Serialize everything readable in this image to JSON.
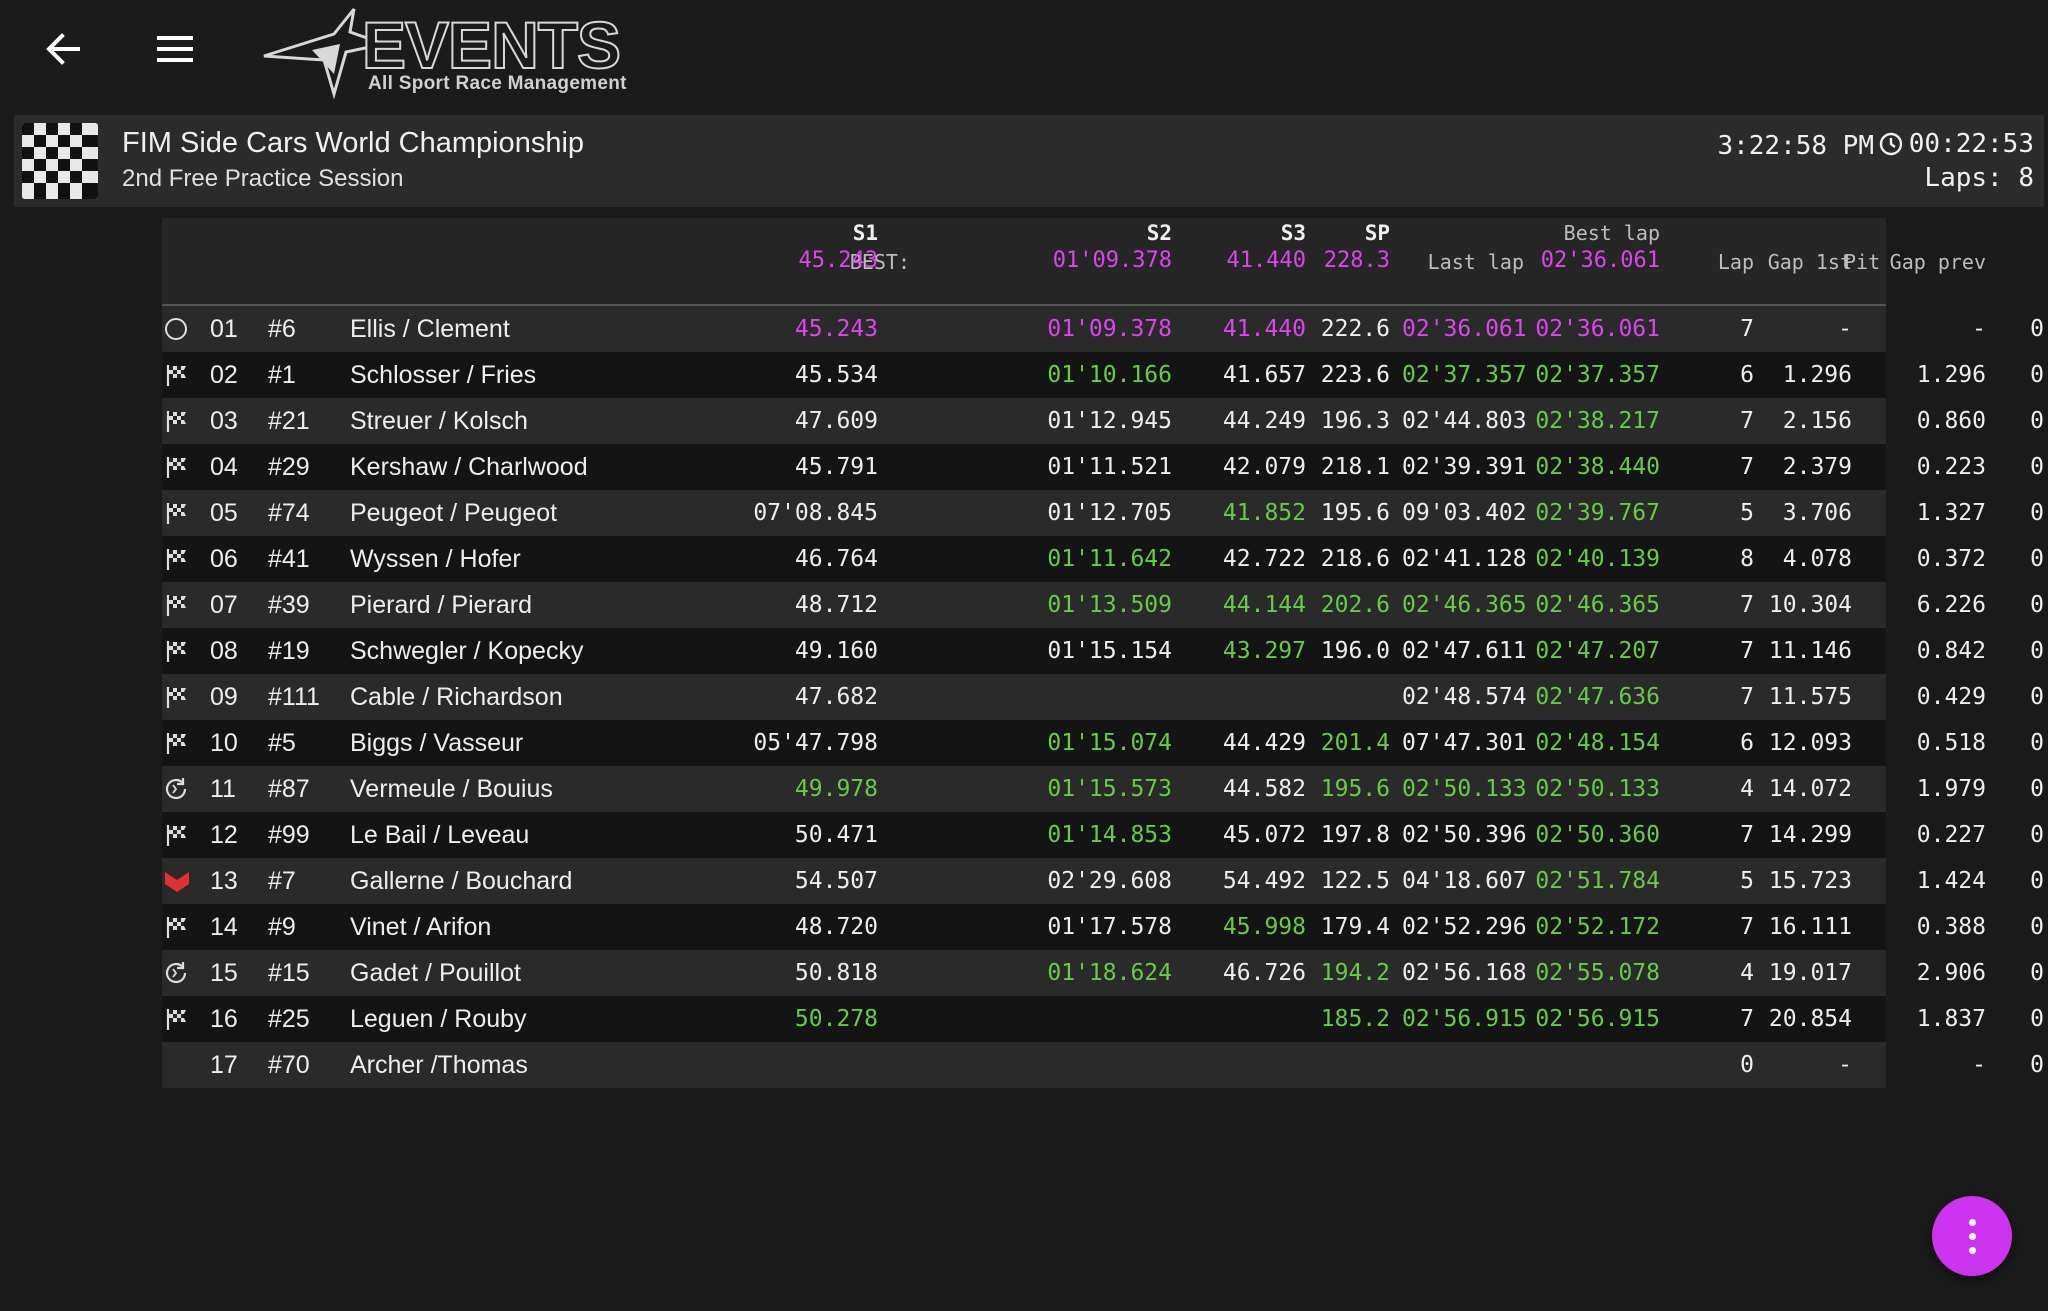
{
  "app": {
    "logo_word": "EVENTS",
    "logo_tagline": "All Sport Race Management"
  },
  "session": {
    "title": "FIM Side Cars World Championship",
    "subtitle": "2nd Free Practice Session",
    "clock": "3:22:58 PM",
    "timer": "00:22:53",
    "laps": "Laps: 8"
  },
  "colors": {
    "best": "#dd44ee",
    "personal": "#66cc44",
    "normal": "#eeeeee",
    "fab": "#cc33ee"
  },
  "header": {
    "best_label": "BEST:",
    "s1": "S1",
    "s2": "S2",
    "s3": "S3",
    "sp": "SP",
    "last_lap": "Last lap",
    "best_lap": "Best lap",
    "lap": "Lap",
    "gap_1st": "Gap 1st",
    "gap_prev": "Gap prev",
    "pit": "Pit",
    "best_s1": "45.243",
    "best_s2": "01'09.378",
    "best_s3": "41.440",
    "best_sp": "228.3",
    "best_lap_val": "02'36.061"
  },
  "rows": [
    {
      "icon": "circle-icon",
      "pos": "01",
      "num": "#6",
      "name": "Ellis / Clement",
      "s1": [
        "45.243",
        "b"
      ],
      "s2": [
        "01'09.378",
        "b"
      ],
      "s3": [
        "41.440",
        "b"
      ],
      "sp": [
        "222.6",
        "n"
      ],
      "last": [
        "02'36.061",
        "b"
      ],
      "best": [
        "02'36.061",
        "b"
      ],
      "lap": "7",
      "gap1": "-",
      "gapp": "-",
      "pit": "0"
    },
    {
      "icon": "checkered-flag-icon",
      "pos": "02",
      "num": "#1",
      "name": "Schlosser / Fries",
      "s1": [
        "45.534",
        "n"
      ],
      "s2": [
        "01'10.166",
        "p"
      ],
      "s3": [
        "41.657",
        "n"
      ],
      "sp": [
        "223.6",
        "n"
      ],
      "last": [
        "02'37.357",
        "p"
      ],
      "best": [
        "02'37.357",
        "p"
      ],
      "lap": "6",
      "gap1": "1.296",
      "gapp": "1.296",
      "pit": "0"
    },
    {
      "icon": "checkered-flag-icon",
      "pos": "03",
      "num": "#21",
      "name": "Streuer / Kolsch",
      "s1": [
        "47.609",
        "n"
      ],
      "s2": [
        "01'12.945",
        "n"
      ],
      "s3": [
        "44.249",
        "n"
      ],
      "sp": [
        "196.3",
        "n"
      ],
      "last": [
        "02'44.803",
        "n"
      ],
      "best": [
        "02'38.217",
        "p"
      ],
      "lap": "7",
      "gap1": "2.156",
      "gapp": "0.860",
      "pit": "0"
    },
    {
      "icon": "checkered-flag-icon",
      "pos": "04",
      "num": "#29",
      "name": "Kershaw / Charlwood",
      "s1": [
        "45.791",
        "n"
      ],
      "s2": [
        "01'11.521",
        "n"
      ],
      "s3": [
        "42.079",
        "n"
      ],
      "sp": [
        "218.1",
        "n"
      ],
      "last": [
        "02'39.391",
        "n"
      ],
      "best": [
        "02'38.440",
        "p"
      ],
      "lap": "7",
      "gap1": "2.379",
      "gapp": "0.223",
      "pit": "0"
    },
    {
      "icon": "checkered-flag-icon",
      "pos": "05",
      "num": "#74",
      "name": "Peugeot / Peugeot",
      "s1": [
        "07'08.845",
        "n"
      ],
      "s2": [
        "01'12.705",
        "n"
      ],
      "s3": [
        "41.852",
        "p"
      ],
      "sp": [
        "195.6",
        "n"
      ],
      "last": [
        "09'03.402",
        "n"
      ],
      "best": [
        "02'39.767",
        "p"
      ],
      "lap": "5",
      "gap1": "3.706",
      "gapp": "1.327",
      "pit": "0"
    },
    {
      "icon": "checkered-flag-icon",
      "pos": "06",
      "num": "#41",
      "name": "Wyssen / Hofer",
      "s1": [
        "46.764",
        "n"
      ],
      "s2": [
        "01'11.642",
        "p"
      ],
      "s3": [
        "42.722",
        "n"
      ],
      "sp": [
        "218.6",
        "n"
      ],
      "last": [
        "02'41.128",
        "n"
      ],
      "best": [
        "02'40.139",
        "p"
      ],
      "lap": "8",
      "gap1": "4.078",
      "gapp": "0.372",
      "pit": "0"
    },
    {
      "icon": "checkered-flag-icon",
      "pos": "07",
      "num": "#39",
      "name": "Pierard / Pierard",
      "s1": [
        "48.712",
        "n"
      ],
      "s2": [
        "01'13.509",
        "p"
      ],
      "s3": [
        "44.144",
        "p"
      ],
      "sp": [
        "202.6",
        "p"
      ],
      "last": [
        "02'46.365",
        "p"
      ],
      "best": [
        "02'46.365",
        "p"
      ],
      "lap": "7",
      "gap1": "10.304",
      "gapp": "6.226",
      "pit": "0"
    },
    {
      "icon": "checkered-flag-icon",
      "pos": "08",
      "num": "#19",
      "name": "Schwegler / Kopecky",
      "s1": [
        "49.160",
        "n"
      ],
      "s2": [
        "01'15.154",
        "n"
      ],
      "s3": [
        "43.297",
        "p"
      ],
      "sp": [
        "196.0",
        "n"
      ],
      "last": [
        "02'47.611",
        "n"
      ],
      "best": [
        "02'47.207",
        "p"
      ],
      "lap": "7",
      "gap1": "11.146",
      "gapp": "0.842",
      "pit": "0"
    },
    {
      "icon": "checkered-flag-icon",
      "pos": "09",
      "num": "#111",
      "name": "Cable / Richardson",
      "s1": [
        "47.682",
        "n"
      ],
      "s2": [
        "",
        "n"
      ],
      "s3": [
        "",
        "n"
      ],
      "sp": [
        "",
        "n"
      ],
      "last": [
        "02'48.574",
        "n"
      ],
      "best": [
        "02'47.636",
        "p"
      ],
      "lap": "7",
      "gap1": "11.575",
      "gapp": "0.429",
      "pit": "0"
    },
    {
      "icon": "checkered-flag-icon",
      "pos": "10",
      "num": "#5",
      "name": "Biggs / Vasseur",
      "s1": [
        "05'47.798",
        "n"
      ],
      "s2": [
        "01'15.074",
        "p"
      ],
      "s3": [
        "44.429",
        "n"
      ],
      "sp": [
        "201.4",
        "p"
      ],
      "last": [
        "07'47.301",
        "n"
      ],
      "best": [
        "02'48.154",
        "p"
      ],
      "lap": "6",
      "gap1": "12.093",
      "gapp": "0.518",
      "pit": "0"
    },
    {
      "icon": "refresh-icon",
      "pos": "11",
      "num": "#87",
      "name": "Vermeule / Bouius",
      "s1": [
        "49.978",
        "p"
      ],
      "s2": [
        "01'15.573",
        "p"
      ],
      "s3": [
        "44.582",
        "n"
      ],
      "sp": [
        "195.6",
        "p"
      ],
      "last": [
        "02'50.133",
        "p"
      ],
      "best": [
        "02'50.133",
        "p"
      ],
      "lap": "4",
      "gap1": "14.072",
      "gapp": "1.979",
      "pit": "0"
    },
    {
      "icon": "checkered-flag-icon",
      "pos": "12",
      "num": "#99",
      "name": "Le Bail / Leveau",
      "s1": [
        "50.471",
        "n"
      ],
      "s2": [
        "01'14.853",
        "p"
      ],
      "s3": [
        "45.072",
        "n"
      ],
      "sp": [
        "197.8",
        "n"
      ],
      "last": [
        "02'50.396",
        "n"
      ],
      "best": [
        "02'50.360",
        "p"
      ],
      "lap": "7",
      "gap1": "14.299",
      "gapp": "0.227",
      "pit": "0"
    },
    {
      "icon": "red-chevron-icon",
      "pos": "13",
      "num": "#7",
      "name": "Gallerne / Bouchard",
      "s1": [
        "54.507",
        "n"
      ],
      "s2": [
        "02'29.608",
        "n"
      ],
      "s3": [
        "54.492",
        "n"
      ],
      "sp": [
        "122.5",
        "n"
      ],
      "last": [
        "04'18.607",
        "n"
      ],
      "best": [
        "02'51.784",
        "p"
      ],
      "lap": "5",
      "gap1": "15.723",
      "gapp": "1.424",
      "pit": "0"
    },
    {
      "icon": "checkered-flag-icon",
      "pos": "14",
      "num": "#9",
      "name": "Vinet / Arifon",
      "s1": [
        "48.720",
        "n"
      ],
      "s2": [
        "01'17.578",
        "n"
      ],
      "s3": [
        "45.998",
        "p"
      ],
      "sp": [
        "179.4",
        "n"
      ],
      "last": [
        "02'52.296",
        "n"
      ],
      "best": [
        "02'52.172",
        "p"
      ],
      "lap": "7",
      "gap1": "16.111",
      "gapp": "0.388",
      "pit": "0"
    },
    {
      "icon": "refresh-icon",
      "pos": "15",
      "num": "#15",
      "name": "Gadet / Pouillot",
      "s1": [
        "50.818",
        "n"
      ],
      "s2": [
        "01'18.624",
        "p"
      ],
      "s3": [
        "46.726",
        "n"
      ],
      "sp": [
        "194.2",
        "p"
      ],
      "last": [
        "02'56.168",
        "n"
      ],
      "best": [
        "02'55.078",
        "p"
      ],
      "lap": "4",
      "gap1": "19.017",
      "gapp": "2.906",
      "pit": "0"
    },
    {
      "icon": "checkered-flag-icon",
      "pos": "16",
      "num": "#25",
      "name": "Leguen / Rouby",
      "s1": [
        "50.278",
        "p"
      ],
      "s2": [
        "",
        "n"
      ],
      "s3": [
        "",
        "n"
      ],
      "sp": [
        "185.2",
        "p"
      ],
      "last": [
        "02'56.915",
        "p"
      ],
      "best": [
        "02'56.915",
        "p"
      ],
      "lap": "7",
      "gap1": "20.854",
      "gapp": "1.837",
      "pit": "0"
    },
    {
      "icon": "none",
      "pos": "17",
      "num": "#70",
      "name": "Archer /Thomas",
      "s1": [
        "",
        "n"
      ],
      "s2": [
        "",
        "n"
      ],
      "s3": [
        "",
        "n"
      ],
      "sp": [
        "",
        "n"
      ],
      "last": [
        "",
        "n"
      ],
      "best": [
        "",
        "n"
      ],
      "lap": "0",
      "gap1": "-",
      "gapp": "-",
      "pit": "0"
    }
  ]
}
